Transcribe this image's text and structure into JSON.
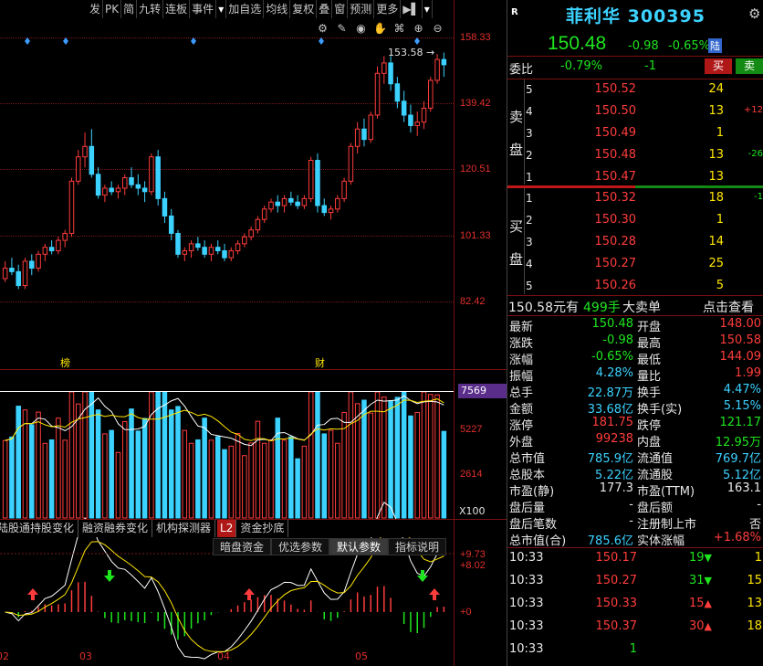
{
  "toolbar": [
    "发",
    "PK",
    "简",
    "九转",
    "连板",
    "事件",
    "▾",
    "加自选",
    "均线",
    "复权",
    "叠",
    "窗",
    "预测",
    "更多",
    "▶▌",
    "▾"
  ],
  "chart_icons": [
    "⚙",
    "✎",
    "◉",
    "✋",
    "⌘",
    "⊕",
    "⊖"
  ],
  "price_axis": [
    "158.33",
    "139.42",
    "120.51",
    "101.33",
    "82.42"
  ],
  "high_annot": "153.58",
  "markers": {
    "bang": "榜",
    "cai": "财"
  },
  "vol_axis": {
    "top": "7569",
    "mid": "5227",
    "low": "2614",
    "unit": "X100"
  },
  "sub_tabs": [
    "陆股通持股变化",
    "融资融券变化",
    "机构探测器",
    "L2",
    "资金抄底"
  ],
  "sub_buttons": [
    "暗盘资金",
    "优选参数",
    "默认参数",
    "指标说明"
  ],
  "ind_axis": {
    "a": "+9.73",
    "b": "+8.02",
    "zero": "+0"
  },
  "x_axis": [
    "02",
    "03",
    "04",
    "05"
  ],
  "colors": {
    "up": "#ff3c3c",
    "down": "#3cd2ff",
    "grid": "#7a1818",
    "vol_line": "#ffffff"
  },
  "chart_data": {
    "type": "candlestick",
    "title": "",
    "ylim": [
      82.42,
      158.33
    ],
    "candles": [
      [
        89,
        94,
        88,
        92
      ],
      [
        92,
        95,
        90,
        91
      ],
      [
        91,
        93,
        86,
        87
      ],
      [
        87,
        95,
        86,
        94
      ],
      [
        94,
        96,
        90,
        92
      ],
      [
        92,
        97,
        91,
        96
      ],
      [
        96,
        99,
        94,
        98
      ],
      [
        98,
        100,
        96,
        97
      ],
      [
        97,
        101,
        96,
        100
      ],
      [
        100,
        103,
        98,
        102
      ],
      [
        102,
        118,
        101,
        117
      ],
      [
        117,
        126,
        116,
        124
      ],
      [
        124,
        131,
        121,
        127
      ],
      [
        127,
        132,
        118,
        119
      ],
      [
        119,
        121,
        112,
        113
      ],
      [
        113,
        116,
        111,
        115
      ],
      [
        115,
        117,
        113,
        114
      ],
      [
        114,
        116,
        112,
        115
      ],
      [
        115,
        119,
        113,
        118
      ],
      [
        118,
        121,
        115,
        116
      ],
      [
        116,
        119,
        113,
        115
      ],
      [
        115,
        117,
        111,
        114
      ],
      [
        114,
        125,
        113,
        124
      ],
      [
        124,
        126,
        110,
        112
      ],
      [
        112,
        114,
        105,
        107
      ],
      [
        107,
        109,
        100,
        102
      ],
      [
        102,
        103,
        95,
        96
      ],
      [
        96,
        98,
        94,
        97
      ],
      [
        97,
        100,
        95,
        99
      ],
      [
        99,
        101,
        97,
        98
      ],
      [
        98,
        100,
        95,
        96
      ],
      [
        96,
        99,
        94,
        98
      ],
      [
        98,
        100,
        96,
        97
      ],
      [
        97,
        99,
        94,
        95
      ],
      [
        95,
        98,
        94,
        97
      ],
      [
        97,
        100,
        96,
        99
      ],
      [
        99,
        102,
        98,
        101
      ],
      [
        101,
        104,
        100,
        103
      ],
      [
        103,
        107,
        102,
        106
      ],
      [
        106,
        110,
        105,
        109
      ],
      [
        109,
        112,
        108,
        111
      ],
      [
        111,
        113,
        108,
        110
      ],
      [
        110,
        113,
        108,
        112
      ],
      [
        112,
        114,
        110,
        111
      ],
      [
        111,
        113,
        109,
        110
      ],
      [
        110,
        113,
        109,
        112
      ],
      [
        112,
        124,
        111,
        123
      ],
      [
        123,
        125,
        108,
        110
      ],
      [
        110,
        112,
        107,
        108
      ],
      [
        108,
        110,
        106,
        109
      ],
      [
        109,
        113,
        108,
        112
      ],
      [
        112,
        118,
        111,
        117
      ],
      [
        117,
        128,
        116,
        127
      ],
      [
        127,
        134,
        125,
        132
      ],
      [
        132,
        135,
        127,
        129
      ],
      [
        129,
        137,
        128,
        136
      ],
      [
        136,
        150,
        135,
        148
      ],
      [
        148,
        153,
        145,
        151
      ],
      [
        151,
        153,
        143,
        145
      ],
      [
        145,
        147,
        138,
        140
      ],
      [
        140,
        143,
        134,
        136
      ],
      [
        136,
        139,
        131,
        133
      ],
      [
        133,
        137,
        130,
        134
      ],
      [
        134,
        140,
        132,
        138
      ],
      [
        138,
        147,
        137,
        146
      ],
      [
        146,
        153.58,
        145,
        152
      ],
      [
        152,
        154,
        147,
        150.48
      ]
    ],
    "volume_max": 7569
  },
  "quote": {
    "flag": "R",
    "name": "菲利华",
    "code": "300395",
    "price": "150.48",
    "chg": "-0.98",
    "chg_pct": "-0.65%",
    "market_tag": "陆",
    "wb_label": "委比",
    "wb_val": "-0.79%",
    "wb_diff": "-1",
    "buy_btn": "买",
    "sell_btn": "卖",
    "sell_label": [
      "卖",
      "盘"
    ],
    "buy_label": [
      "买",
      "盘"
    ],
    "asks": [
      {
        "lvl": "5",
        "px": "150.52",
        "vol": "24",
        "chg": ""
      },
      {
        "lvl": "4",
        "px": "150.50",
        "vol": "13",
        "chg": "+12"
      },
      {
        "lvl": "3",
        "px": "150.49",
        "vol": "1",
        "chg": ""
      },
      {
        "lvl": "2",
        "px": "150.48",
        "vol": "13",
        "chg": "-26"
      },
      {
        "lvl": "1",
        "px": "150.47",
        "vol": "13",
        "chg": ""
      }
    ],
    "bids": [
      {
        "lvl": "1",
        "px": "150.32",
        "vol": "18",
        "chg": "-1"
      },
      {
        "lvl": "2",
        "px": "150.30",
        "vol": "1",
        "chg": ""
      },
      {
        "lvl": "3",
        "px": "150.28",
        "vol": "14",
        "chg": ""
      },
      {
        "lvl": "4",
        "px": "150.27",
        "vol": "25",
        "chg": ""
      },
      {
        "lvl": "5",
        "px": "150.26",
        "vol": "5",
        "chg": ""
      }
    ],
    "big_order": {
      "px": "150.58元有",
      "vol": "499手",
      "label": "大卖单",
      "link": "点击查看"
    },
    "stats": [
      {
        "k1": "最新",
        "v1": "150.48",
        "c1": "green",
        "k2": "开盘",
        "v2": "148.00",
        "c2": "red"
      },
      {
        "k1": "涨跌",
        "v1": "-0.98",
        "c1": "green",
        "k2": "最高",
        "v2": "150.58",
        "c2": "red"
      },
      {
        "k1": "涨幅",
        "v1": "-0.65%",
        "c1": "green",
        "k2": "最低",
        "v2": "144.09",
        "c2": "red"
      },
      {
        "k1": "振幅",
        "v1": "4.28%",
        "c1": "cyan",
        "k2": "量比",
        "v2": "1.99",
        "c2": "red"
      },
      {
        "k1": "总手",
        "v1": "22.87万",
        "c1": "cyan",
        "k2": "换手",
        "v2": "4.47%",
        "c2": "cyan"
      },
      {
        "k1": "金额",
        "v1": "33.68亿",
        "c1": "cyan",
        "k2": "换手(实)",
        "v2": "5.15%",
        "c2": "cyan"
      },
      {
        "k1": "涨停",
        "v1": "181.75",
        "c1": "red",
        "k2": "跌停",
        "v2": "121.17",
        "c2": "green"
      },
      {
        "k1": "外盘",
        "v1": "99238",
        "c1": "red",
        "k2": "内盘",
        "v2": "12.95万",
        "c2": "green"
      },
      {
        "k1": "总市值",
        "v1": "785.9亿",
        "c1": "cyan",
        "k2": "流通值",
        "v2": "769.7亿",
        "c2": "cyan"
      },
      {
        "k1": "总股本",
        "v1": "5.22亿",
        "c1": "cyan",
        "k2": "流通股",
        "v2": "5.12亿",
        "c2": "cyan"
      },
      {
        "k1": "市盈(静)",
        "v1": "177.3",
        "c1": "white",
        "k2": "市盈(TTM)",
        "v2": "163.1",
        "c2": "white"
      },
      {
        "k1": "盘后量",
        "v1": "-",
        "c1": "white",
        "k2": "盘后额",
        "v2": "-",
        "c2": "white"
      },
      {
        "k1": "盘后笔数",
        "v1": "-",
        "c1": "white",
        "k2": "注册制上市",
        "v2": "否",
        "c2": "white"
      },
      {
        "k1": "总市值(合)",
        "v1": "785.6亿",
        "c1": "cyan",
        "k2": "实体涨幅",
        "v2": "+1.68%",
        "c2": "red"
      }
    ],
    "ticks": [
      {
        "t": "10:33",
        "p": "150.17",
        "v": "19",
        "dir": "down",
        "n": "1"
      },
      {
        "t": "10:33",
        "p": "150.27",
        "v": "31",
        "dir": "down",
        "n": "15"
      },
      {
        "t": "10:33",
        "p": "150.33",
        "v": "15",
        "dir": "up",
        "n": "13"
      },
      {
        "t": "10:33",
        "p": "150.37",
        "v": "30",
        "dir": "up",
        "n": "18"
      },
      {
        "t": "10:33",
        "p": "1",
        "v": "",
        "dir": "",
        "n": ""
      }
    ]
  }
}
